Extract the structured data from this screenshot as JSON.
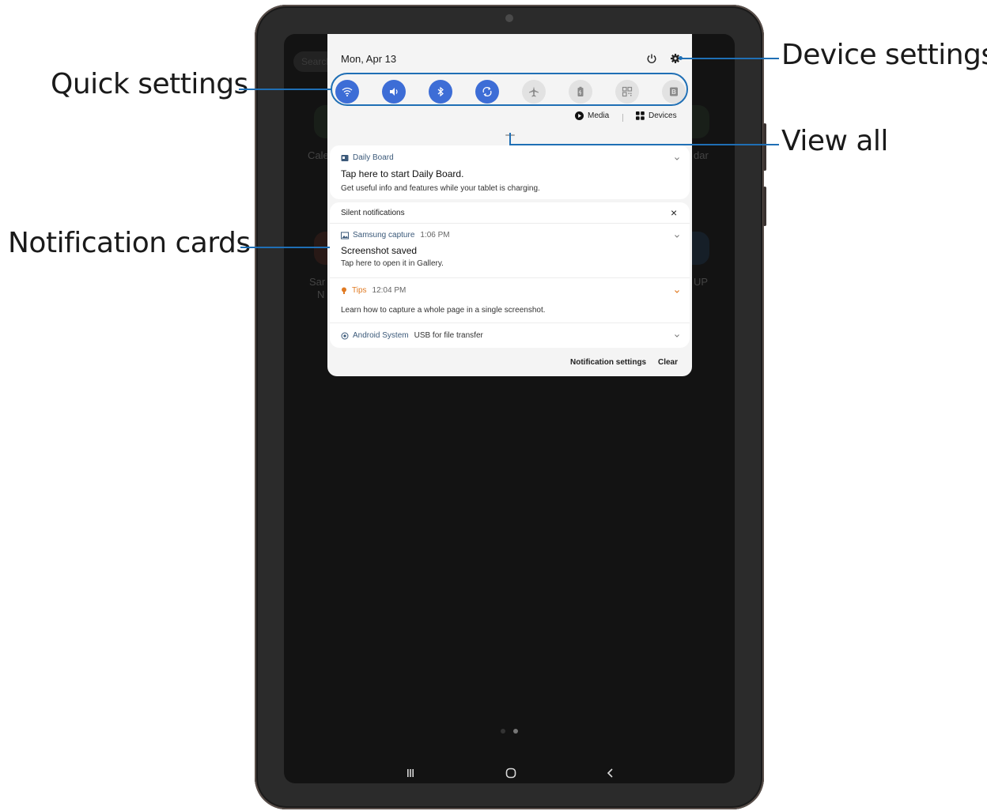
{
  "callouts": {
    "quick_settings": "Quick settings",
    "device_settings": "Device settings",
    "view_all": "View all",
    "notification_cards": "Notification cards"
  },
  "background": {
    "search_placeholder": "Search",
    "app_label_left": "Cale",
    "app_label_right": "dar",
    "app_label_left2": "Sar",
    "app_label_left3": "N",
    "app_label_right2": "UP"
  },
  "panel": {
    "date": "Mon, Apr 13",
    "quick_settings": [
      {
        "icon": "wifi-icon",
        "state": "on"
      },
      {
        "icon": "sound-icon",
        "state": "on"
      },
      {
        "icon": "bluetooth-icon",
        "state": "on"
      },
      {
        "icon": "auto-rotate-icon",
        "state": "on"
      },
      {
        "icon": "airplane-icon",
        "state": "off"
      },
      {
        "icon": "power-saving-icon",
        "state": "off"
      },
      {
        "icon": "qr-scanner-icon",
        "state": "off"
      },
      {
        "icon": "b-icon",
        "state": "off"
      }
    ],
    "media_label": "Media",
    "devices_label": "Devices",
    "daily_board": {
      "app": "Daily Board",
      "title": "Tap here to start Daily Board.",
      "text": "Get useful info and features while your tablet is charging."
    },
    "silent_label": "Silent notifications",
    "capture": {
      "app": "Samsung capture",
      "time": "1:06 PM",
      "title": "Screenshot saved",
      "text": "Tap here to open it in Gallery."
    },
    "tips": {
      "app": "Tips",
      "time": "12:04 PM",
      "text": "Learn how to capture a whole page in a single screenshot."
    },
    "android": {
      "app": "Android System",
      "text": "USB for file transfer"
    },
    "footer": {
      "settings_label": "Notification settings",
      "clear_label": "Clear"
    }
  },
  "colors": {
    "accent": "#3d6dd6",
    "callout_line": "#1f6fb5",
    "tips_orange": "#e07a22"
  }
}
